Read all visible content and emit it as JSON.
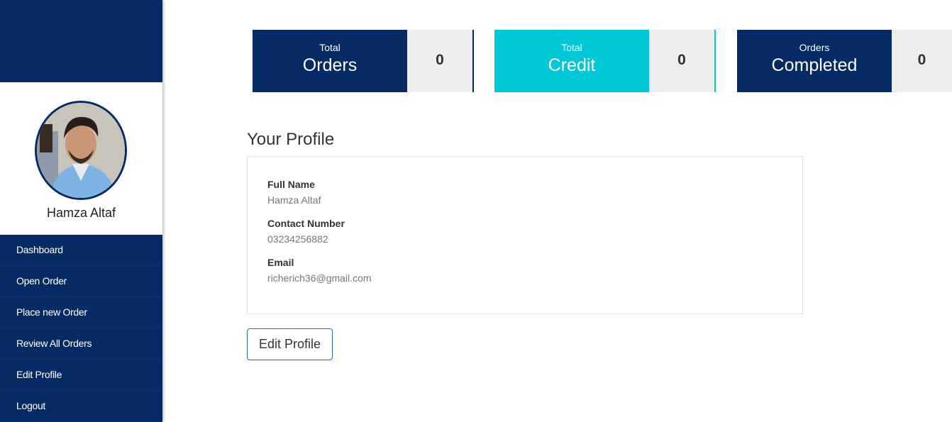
{
  "user": {
    "name": "Hamza Altaf"
  },
  "nav": [
    {
      "label": "Dashboard"
    },
    {
      "label": "Open Order"
    },
    {
      "label": "Place new Order"
    },
    {
      "label": "Review All Orders"
    },
    {
      "label": "Edit Profile"
    },
    {
      "label": "Logout"
    }
  ],
  "cards": [
    {
      "small": "Total",
      "big": "Orders",
      "count": "0",
      "color": "#062a63"
    },
    {
      "small": "Total",
      "big": "Credit",
      "count": "0",
      "color": "#00c8d6"
    },
    {
      "small": "Orders",
      "big": "Completed",
      "count": "0",
      "color": "#062a63"
    }
  ],
  "profile": {
    "title": "Your Profile",
    "full_name_label": "Full Name",
    "full_name": "Hamza Altaf",
    "contact_label": "Contact Number",
    "contact": "03234256882",
    "email_label": "Email",
    "email": "richerich36@gmail.com",
    "edit_button": "Edit Profile"
  }
}
